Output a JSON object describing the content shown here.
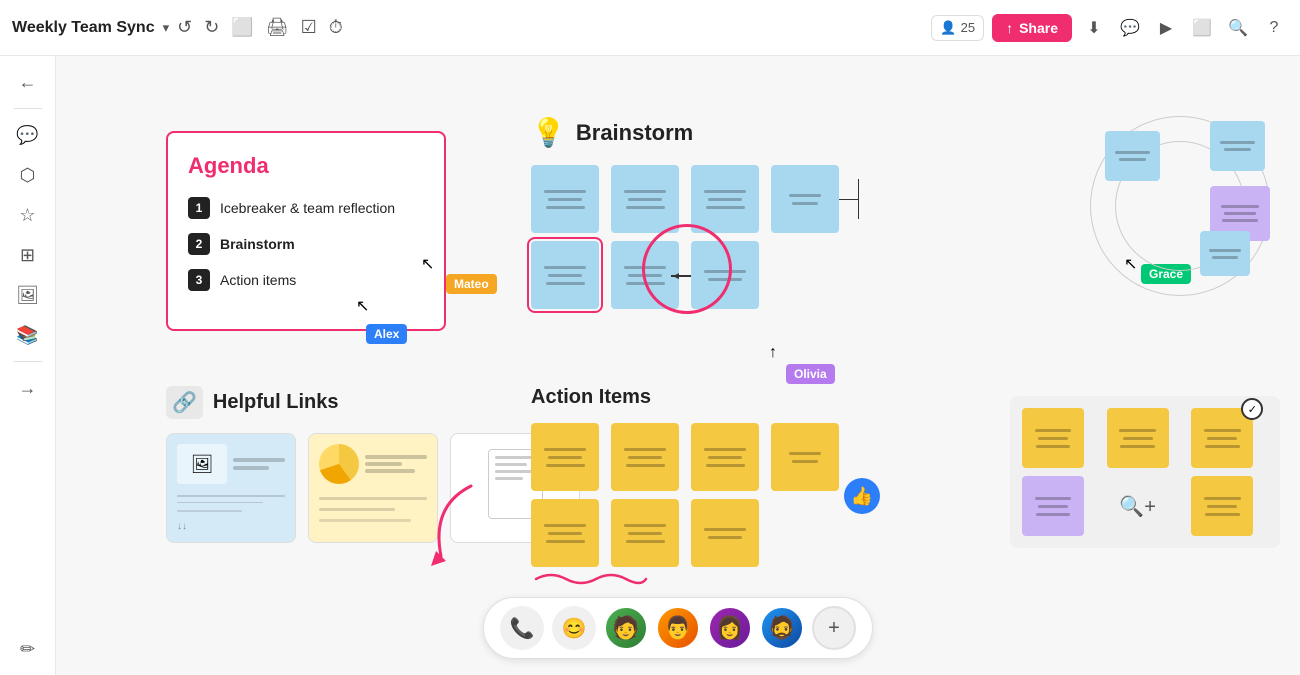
{
  "app": {
    "title": "Weekly Team Sync",
    "title_arrow": "▾"
  },
  "topbar": {
    "tools": [
      "↺",
      "↻",
      "⬜",
      "⬛",
      "☑",
      "⏱"
    ],
    "users_count": "25",
    "share_label": "Share",
    "share_icon": "↑"
  },
  "topbar_right_icons": [
    "👤",
    "💬",
    "⇄",
    "⬜",
    "🔍",
    "?"
  ],
  "sidebar": {
    "icons": [
      "←",
      "💬",
      "⬡",
      "☆",
      "⊞",
      "🖼",
      "📚",
      "→",
      "✏"
    ]
  },
  "agenda": {
    "title": "Agenda",
    "items": [
      {
        "num": "1",
        "label": "Icebreaker & team reflection"
      },
      {
        "num": "2",
        "label": "Brainstorm"
      },
      {
        "num": "3",
        "label": "Action items"
      }
    ]
  },
  "brainstorm": {
    "title": "Brainstorm",
    "icon": "💡"
  },
  "helpful_links": {
    "title": "Helpful Links",
    "icon": "🔗"
  },
  "action_items": {
    "title": "Action Items"
  },
  "cursors": {
    "mateo": "Mateo",
    "alex": "Alex",
    "olivia": "Olivia",
    "grace": "Grace"
  },
  "bottom_bar": {
    "phone_icon": "📞",
    "emoji_icon": "😊",
    "add_icon": "+"
  }
}
